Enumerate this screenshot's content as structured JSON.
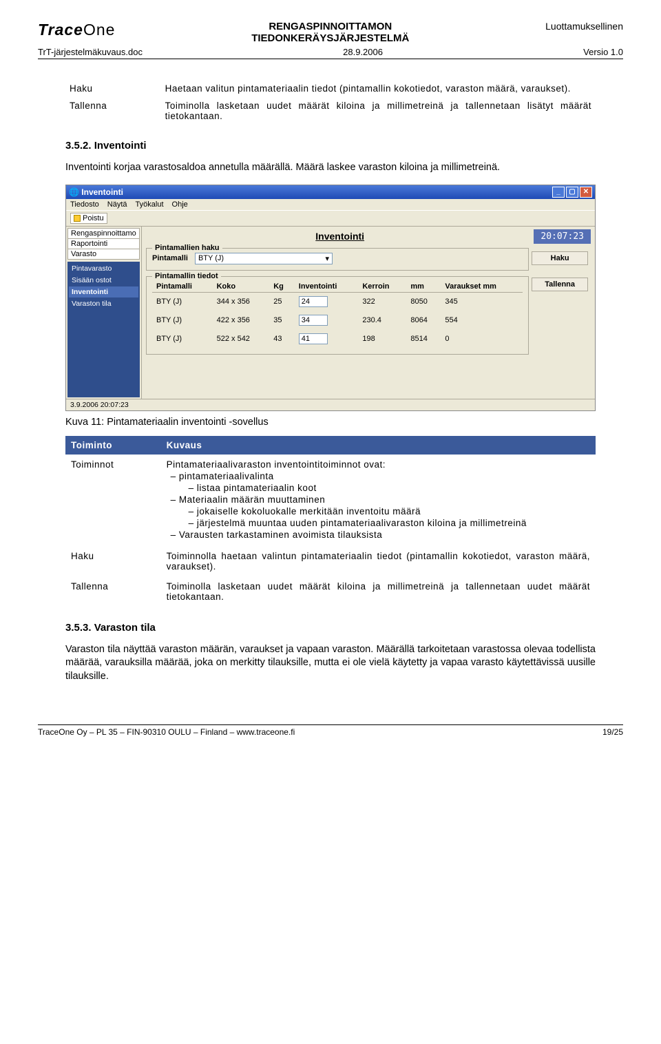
{
  "header": {
    "logo_text": "TraceOne",
    "title1": "RENGASPINNOITTAMON",
    "title2": "TIEDONKERÄYSJÄRJESTELMÄ",
    "right1": "Luottamuksellinen",
    "doc_left": "TrT-järjestelmäkuvaus.doc",
    "doc_center": "28.9.2006",
    "doc_right": "Versio 1.0"
  },
  "table1": {
    "rows": [
      {
        "left": "Haku",
        "right": "Haetaan valitun pintamateriaalin tiedot (pintamallin kokotiedot, varaston määrä, varaukset)."
      },
      {
        "left": "Tallenna",
        "right": "Toiminolla lasketaan uudet määrät kiloina ja millimetreinä ja tallennetaan lisätyt määrät tietokantaan."
      }
    ]
  },
  "sec352": {
    "num": "3.5.2. Inventointi",
    "para": "Inventointi korjaa varastosaldoa annetulla määrällä. Määrä laskee varaston kiloina ja millimetreinä."
  },
  "app": {
    "title": "Inventointi",
    "menu": [
      "Tiedosto",
      "Näytä",
      "Työkalut",
      "Ohje"
    ],
    "toolbtn": "Poistu",
    "side_top": [
      "Rengaspinnoittamo",
      "Raportointi",
      "Varasto"
    ],
    "side_bot": [
      "Pintavarasto",
      "Sisään ostot",
      "Inventointi",
      "Varaston tila"
    ],
    "main_title": "Inventointi",
    "clock": "20:07:23",
    "group1_label": "Pintamallien haku",
    "pintamalli_label": "Pintamalli",
    "pintamalli_value": "BTY (J)",
    "btn_haku": "Haku",
    "btn_tallenna": "Tallenna",
    "group2_label": "Pintamallin tiedot",
    "cols": [
      "Pintamalli",
      "Koko",
      "Kg",
      "Inventointi",
      "Kerroin",
      "mm",
      "Varaukset mm"
    ],
    "status": "3.9.2006 20:07:23"
  },
  "chart_data": {
    "type": "table",
    "columns": [
      "Pintamalli",
      "Koko",
      "Kg",
      "Inventointi",
      "Kerroin",
      "mm",
      "Varaukset mm"
    ],
    "rows": [
      [
        "BTY (J)",
        "344 x 356",
        25,
        24,
        322,
        8050,
        345
      ],
      [
        "BTY (J)",
        "422 x 356",
        35,
        34,
        230.4,
        8064,
        554
      ],
      [
        "BTY (J)",
        "522 x 542",
        43,
        41,
        198,
        8514,
        0
      ]
    ]
  },
  "caption11": "Kuva 11: Pintamateriaalin inventointi -sovellus",
  "table2": {
    "head_left": "Toiminto",
    "head_right": "Kuvaus",
    "r1_left": "Toiminnot",
    "r1_intro": "Pintamateriaalivaraston inventointitoiminnot ovat:",
    "b1": "pintamateriaalivalinta",
    "b1a": "listaa pintamateriaalin koot",
    "b2": "Materiaalin määrän muuttaminen",
    "b2a": "jokaiselle kokoluokalle merkitään inventoitu määrä",
    "b2b": "järjestelmä muuntaa uuden pintamateriaalivaraston kiloina ja millimetreinä",
    "b3": "Varausten tarkastaminen avoimista tilauksista",
    "r2_left": "Haku",
    "r2_right": "Toiminnolla haetaan valintun pintamateriaalin tiedot (pintamallin kokotiedot, varaston määrä, varaukset).",
    "r3_left": "Tallenna",
    "r3_right": "Toiminolla lasketaan uudet määrät kiloina ja millimetreinä ja tallennetaan uudet määrät tietokantaan."
  },
  "sec353": {
    "num": "3.5.3. Varaston tila",
    "para": "Varaston tila näyttää varaston määrän, varaukset ja vapaan varaston. Määrällä tarkoitetaan varastossa olevaa todellista määrää, varauksilla määrää, joka on merkitty tilauksille, mutta ei ole vielä käytetty ja vapaa varasto käytettävissä uusille tilauksille."
  },
  "footer": {
    "left": "TraceOne Oy – PL 35 – FIN-90310 OULU – Finland – www.traceone.fi",
    "right": "19/25"
  }
}
